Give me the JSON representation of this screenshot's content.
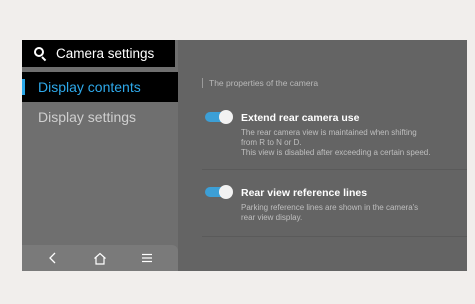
{
  "header": {
    "title": "Camera settings",
    "icon": "search-icon"
  },
  "sidebar": {
    "items": [
      {
        "label": "Display contents",
        "active": true
      },
      {
        "label": "Display settings",
        "active": false
      }
    ],
    "active_color": "#2ea9ea"
  },
  "navbar": {
    "buttons": [
      "back-icon",
      "home-icon",
      "menu-icon"
    ]
  },
  "main": {
    "section_title": "The properties of the camera",
    "options": [
      {
        "title": "Extend rear camera use",
        "description_lines": [
          "The rear camera view is maintained when shifting",
          "from R to N or D.",
          "This view is disabled after exceeding a certain speed."
        ],
        "enabled": true
      },
      {
        "title": "Rear view reference lines",
        "description_lines": [
          "Parking reference lines are shown in the camera's",
          "rear view display."
        ],
        "enabled": true
      }
    ],
    "toggle_color": "#3c9fd6"
  }
}
